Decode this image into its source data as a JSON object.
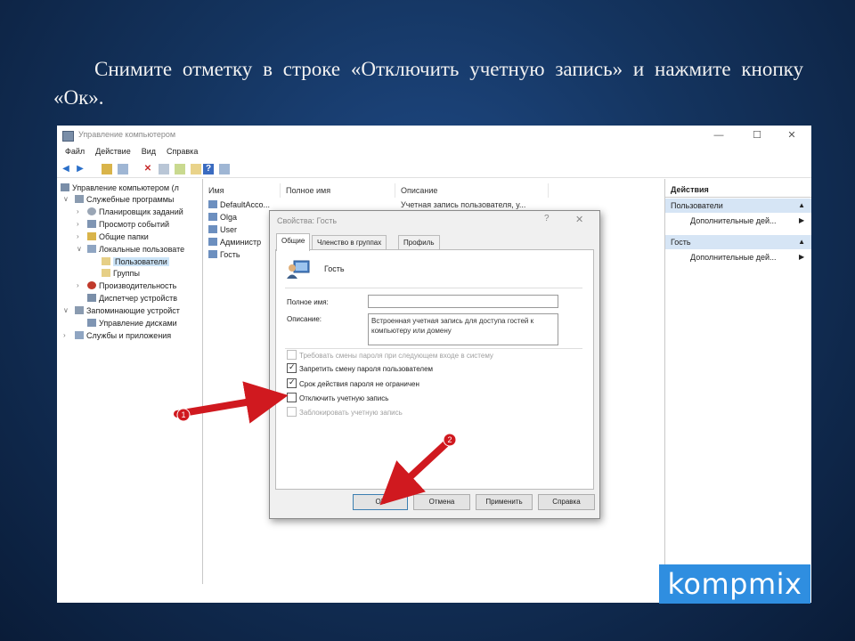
{
  "instruction": "Снимите отметку в строке «Отключить учетную запись» и нажмите кнопку «Ок».",
  "window": {
    "title": "Управление компьютером",
    "controls": {
      "minimize": "—",
      "maximize": "☐",
      "close": "✕"
    }
  },
  "menu": [
    "Файл",
    "Действие",
    "Вид",
    "Справка"
  ],
  "tree": {
    "items": [
      "Управление компьютером (л",
      "Служебные программы",
      "Планировщик заданий",
      "Просмотр событий",
      "Общие папки",
      "Локальные пользовате",
      "Пользователи",
      "Группы",
      "Производительность",
      "Диспетчер устройств",
      "Запоминающие устройст",
      "Управление дисками",
      "Службы и приложения"
    ]
  },
  "list": {
    "columns": [
      "Имя",
      "Полное имя",
      "Описание"
    ],
    "rows": [
      "DefaultAcco...",
      "Olga",
      "User",
      "Администр",
      "Гость"
    ],
    "first_description": "Учетная запись пользователя, у..."
  },
  "actions": {
    "header": "Действия",
    "sections": [
      {
        "title": "Пользователи",
        "item": "Дополнительные дей..."
      },
      {
        "title": "Гость",
        "item": "Дополнительные дей..."
      }
    ]
  },
  "dialog": {
    "title": "Свойства: Гость",
    "help": "?",
    "close": "✕",
    "tabs": [
      "Общие",
      "Членство в группах",
      "Профиль"
    ],
    "user_name": "Гость",
    "full_name_label": "Полное имя:",
    "full_name_value": "",
    "description_label": "Описание:",
    "description_value": "Встроенная учетная запись для доступа гостей к компьютеру или домену",
    "checkboxes": [
      {
        "label": "Требовать смены пароля при следующем входе в систему",
        "checked": false,
        "disabled": true
      },
      {
        "label": "Запретить смену пароля пользователем",
        "checked": true,
        "disabled": false
      },
      {
        "label": "Срок действия пароля не ограничен",
        "checked": true,
        "disabled": false
      },
      {
        "label": "Отключить учетную запись",
        "checked": false,
        "disabled": false
      },
      {
        "label": "Заблокировать учетную запись",
        "checked": false,
        "disabled": true
      }
    ],
    "buttons": [
      "ОК",
      "Отмена",
      "Применить",
      "Справка"
    ]
  },
  "annotations": {
    "step1": "1",
    "step2": "2",
    "arrow_color": "#d0191f"
  },
  "logo": "kompmix",
  "colors": {
    "background": "#14345f",
    "logo": "#2f8ee0",
    "selection": "#cce4f7",
    "actions_section": "#d6e5f5"
  }
}
